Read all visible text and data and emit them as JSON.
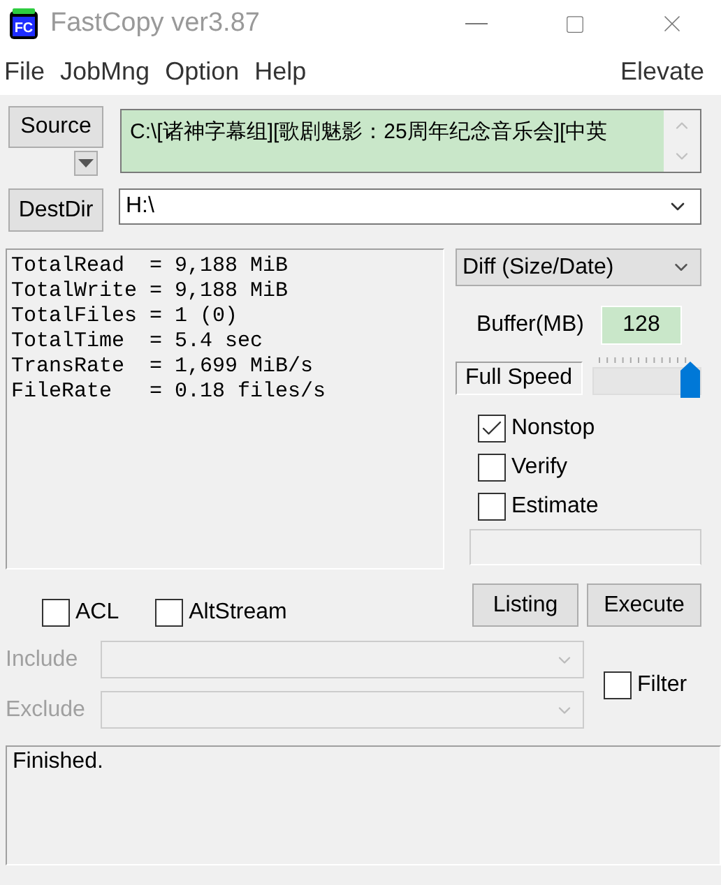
{
  "window": {
    "title": "FastCopy ver3.87",
    "logo": "FC"
  },
  "menu": [
    {
      "label": "File"
    },
    {
      "label": "JobMng"
    },
    {
      "label": "Option"
    },
    {
      "label": "Help"
    }
  ],
  "elevate": "Elevate",
  "source": {
    "button": "Source",
    "value": "C:\\[诸神字幕组][歌剧魅影：25周年纪念音乐会][中英"
  },
  "dest": {
    "button": "DestDir",
    "value": "H:\\"
  },
  "stats": [
    "TotalRead  = 9,188 MiB",
    "TotalWrite = 9,188 MiB",
    "TotalFiles = 1 (0)",
    "TotalTime  = 5.4 sec",
    "TransRate  = 1,699 MiB/s",
    "FileRate   = 0.18 files/s"
  ],
  "mode": "Diff (Size/Date)",
  "buffer": {
    "label": "Buffer(MB)",
    "value": "128"
  },
  "speed": {
    "label": "Full Speed",
    "level": 1
  },
  "options": [
    {
      "label": "Nonstop",
      "checked": true
    },
    {
      "label": "Verify",
      "checked": false
    },
    {
      "label": "Estimate",
      "checked": false
    }
  ],
  "extras": [
    {
      "label": "ACL",
      "checked": false
    },
    {
      "label": "AltStream",
      "checked": false
    }
  ],
  "buttons": [
    "Listing",
    "Execute"
  ],
  "filters": [
    {
      "label": "Include",
      "disabled": true
    },
    {
      "label": "Exclude",
      "disabled": true
    }
  ],
  "filter_check": {
    "label": "Filter",
    "checked": false
  },
  "status": "Finished."
}
